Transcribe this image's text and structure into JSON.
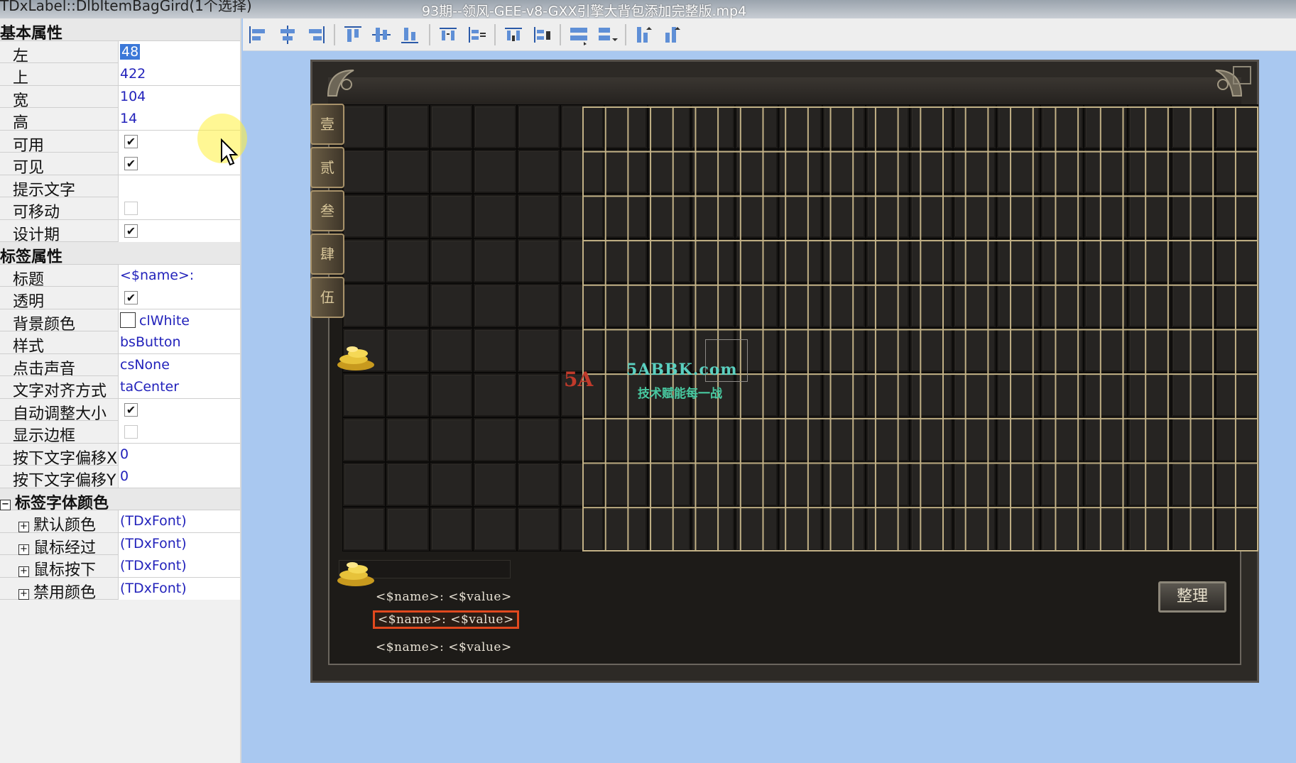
{
  "window": {
    "title_left": "TDxLabel::DlbItemBagGird(1个选择)",
    "video_title": "93期--领风-GEE-v8-GXX引擎大背包添加完整版.mp4"
  },
  "inspector": {
    "section_basic": "基本属性",
    "left_label": "左",
    "left_value": "48",
    "top_label": "上",
    "top_value": "422",
    "width_label": "宽",
    "width_value": "104",
    "height_label": "高",
    "height_value": "14",
    "enabled_label": "可用",
    "enabled_checked": true,
    "visible_label": "可见",
    "visible_checked": true,
    "hint_label": "提示文字",
    "hint_value": "",
    "movable_label": "可移动",
    "movable_checked": false,
    "design_label": "设计期",
    "design_checked": true,
    "section_label": "标签属性",
    "caption_label": "标题",
    "caption_value": "<$name>:",
    "transparent_label": "透明",
    "transparent_checked": true,
    "bgcolor_label": "背景颜色",
    "bgcolor_value": "clWhite",
    "style_label": "样式",
    "style_value": "bsButton",
    "sound_label": "点击声音",
    "sound_value": "csNone",
    "align_label": "文字对齐方式",
    "align_value": "taCenter",
    "autosize_label": "自动调整大小",
    "autosize_checked": true,
    "border_label": "显示边框",
    "border_checked": false,
    "offsetx_label": "按下文字偏移X",
    "offsetx_value": "0",
    "offsety_label": "按下文字偏移Y",
    "offsety_value": "0",
    "section_font": "标签字体颜色",
    "font_default_label": "默认颜色",
    "font_default_value": "(TDxFont)",
    "font_hover_label": "鼠标经过",
    "font_hover_value": "(TDxFont)",
    "font_down_label": "鼠标按下",
    "font_down_value": "(TDxFont)",
    "font_disabled_label": "禁用颜色",
    "font_disabled_value": "(TDxFont)",
    "check_mark": "✔",
    "expand_minus": "−",
    "expand_plus": "+"
  },
  "toolbar": {
    "buttons": [
      "align-left",
      "align-center-h",
      "align-right",
      "align-top",
      "align-center-v",
      "align-bottom",
      "space-h",
      "space-h-equal",
      "space-v",
      "space-v-equal",
      "same-width",
      "same-height",
      "bring-front",
      "send-back"
    ]
  },
  "bag": {
    "tabs": [
      "壹",
      "贰",
      "叁",
      "肆",
      "伍"
    ],
    "info_lines": [
      "<$name>: <$value>",
      "<$name>: <$value>",
      "<$name>: <$value>"
    ],
    "sort_button": "整理",
    "grid_cols": 21,
    "grid_rows": 10
  },
  "watermark": {
    "logo": "5A",
    "site": "5ABBK.com",
    "slogan": "技术赋能每一战"
  },
  "colors": {
    "desktop_bg": "#a9c8f0",
    "grid_line_gold": "#c2b186",
    "selected_border": "#e2491e"
  }
}
